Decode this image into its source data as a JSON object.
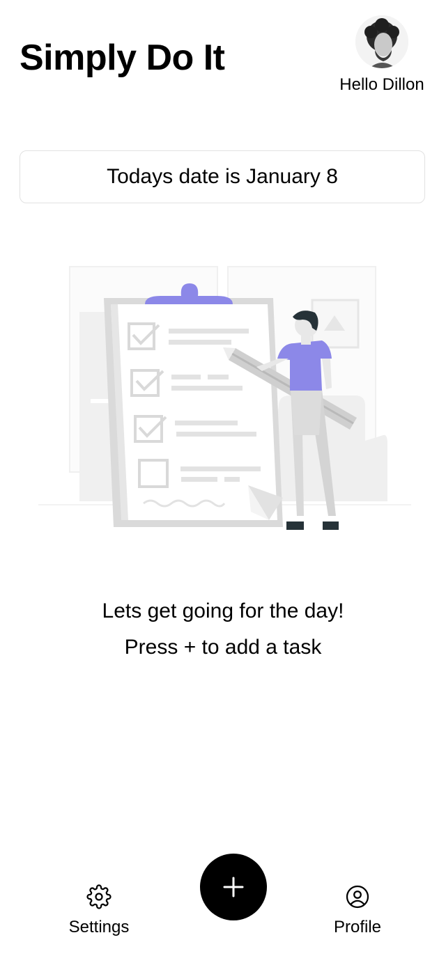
{
  "header": {
    "title": "Simply Do It",
    "greeting": "Hello Dillon"
  },
  "date_card": {
    "text": "Todays date is January 8"
  },
  "empty_state": {
    "illustration": "clipboard-checklist-illustration",
    "line1": "Lets get going for the day!",
    "line2": "Press + to add a task"
  },
  "bottom_nav": {
    "settings": {
      "label": "Settings",
      "icon": "gear-icon"
    },
    "add": {
      "icon": "plus-icon"
    },
    "profile": {
      "label": "Profile",
      "icon": "user-circle-icon"
    }
  },
  "colors": {
    "accent": "#8c88e8",
    "text": "#000000",
    "card_border": "#e1e1e1",
    "illustration_gray": "#e0e0e0",
    "fab": "#000000"
  }
}
